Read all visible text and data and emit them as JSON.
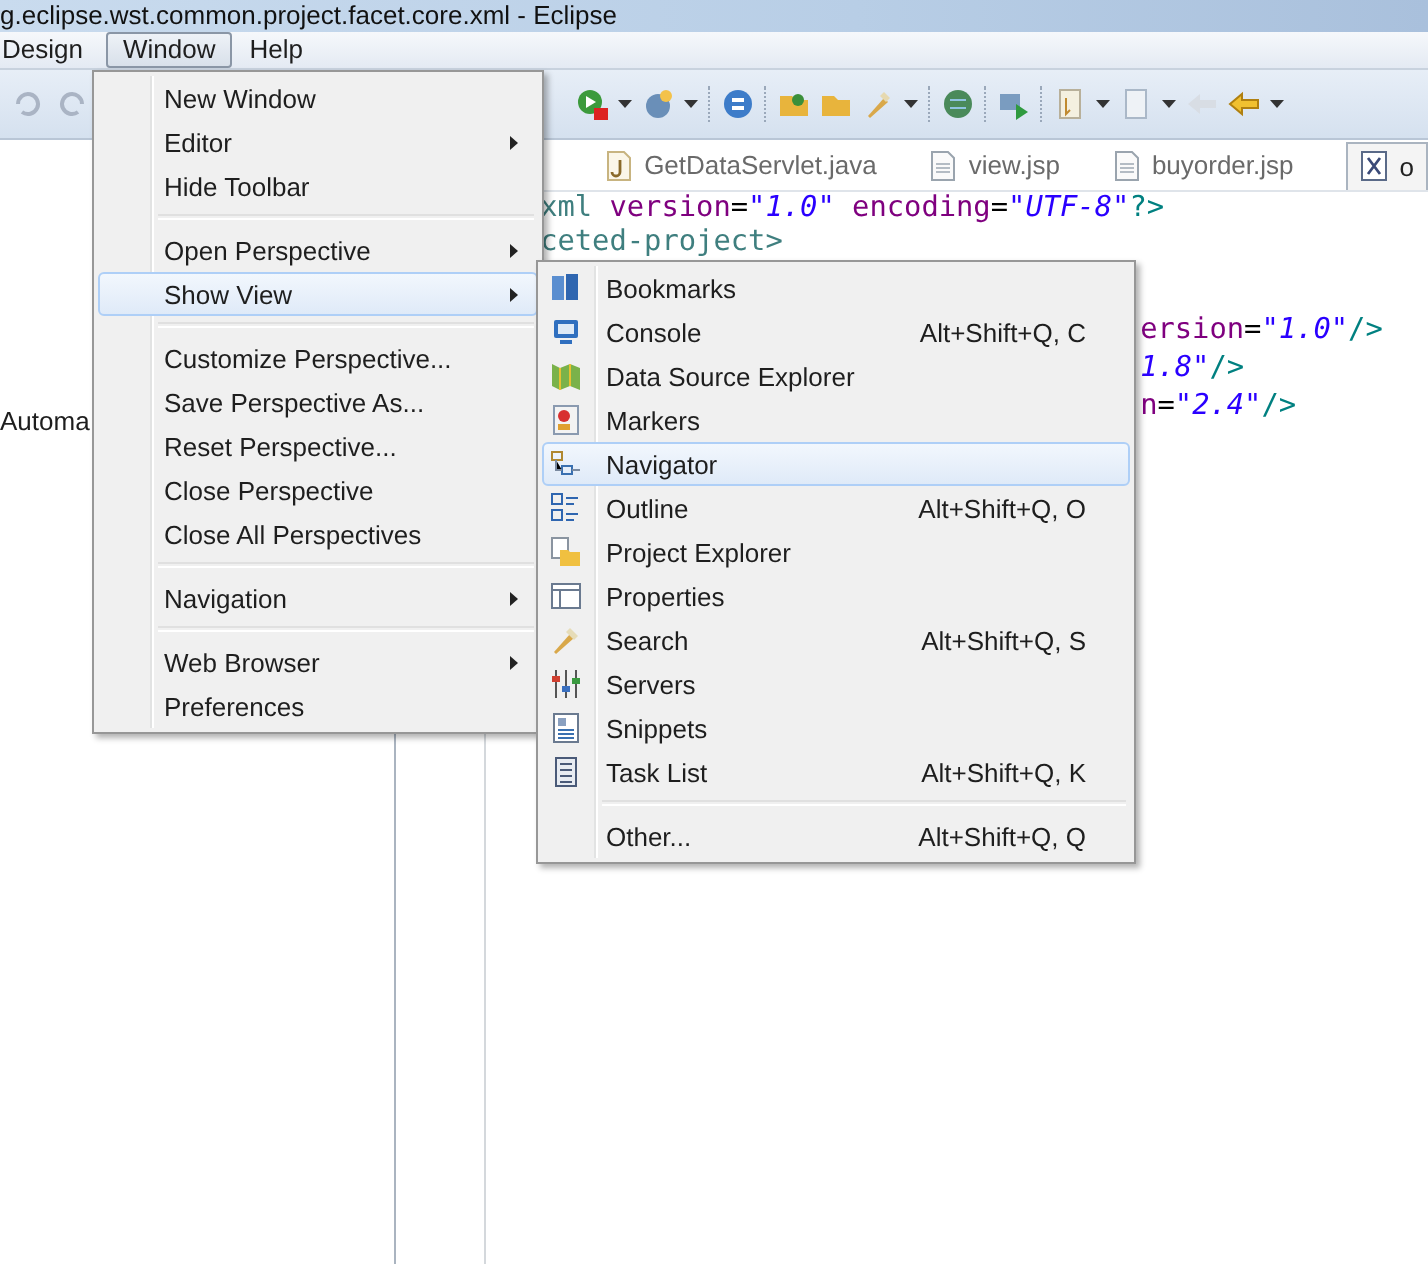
{
  "window": {
    "title": "g.eclipse.wst.common.project.facet.core.xml - Eclipse"
  },
  "menu_bar": [
    {
      "label": "Design",
      "selected": false
    },
    {
      "label": "Window",
      "selected": true
    },
    {
      "label": "Help",
      "selected": false
    }
  ],
  "left_panel": {
    "text": "Automa"
  },
  "editor_tabs": [
    {
      "label": "GetDataServlet.java",
      "kind": "java",
      "selected": false
    },
    {
      "label": "view.jsp",
      "kind": "page",
      "selected": false
    },
    {
      "label": "buyorder.jsp",
      "kind": "page",
      "selected": false
    },
    {
      "label": "o",
      "kind": "xml",
      "selected": true
    }
  ],
  "code_lines": [
    {
      "kind": "left",
      "segments": [
        {
          "text": "xml",
          "kind": "tag"
        },
        {
          "text": " version",
          "kind": "attr"
        },
        {
          "text": "=",
          "kind": "plain"
        },
        {
          "text": "\"1.0\"",
          "kind": "value"
        },
        {
          "text": " encoding",
          "kind": "attr"
        },
        {
          "text": "=",
          "kind": "plain"
        },
        {
          "text": "\"UTF-8\"",
          "kind": "value"
        },
        {
          "text": "?>",
          "kind": "bracket"
        }
      ]
    },
    {
      "kind": "left",
      "segments": [
        {
          "text": "ceted-project>",
          "kind": "tag"
        }
      ]
    },
    {
      "kind": "right",
      "segments": [
        {
          "text": "ersion",
          "kind": "attr"
        },
        {
          "text": "=",
          "kind": "plain"
        },
        {
          "text": "\"1.0\"",
          "kind": "value"
        },
        {
          "text": "/>",
          "kind": "bracket"
        }
      ]
    },
    {
      "kind": "right",
      "segments": [
        {
          "text": "1.8\"",
          "kind": "value"
        },
        {
          "text": "/>",
          "kind": "bracket"
        }
      ]
    },
    {
      "kind": "right",
      "segments": [
        {
          "text": "n",
          "kind": "attr"
        },
        {
          "text": "=",
          "kind": "plain"
        },
        {
          "text": "\"2.4\"",
          "kind": "value"
        },
        {
          "text": "/>",
          "kind": "bracket"
        }
      ]
    }
  ],
  "window_menu": [
    {
      "kind": "item",
      "label": "New Window",
      "submenu": false,
      "selected": false
    },
    {
      "kind": "item",
      "label": "Editor",
      "submenu": true,
      "selected": false
    },
    {
      "kind": "item",
      "label": "Hide Toolbar",
      "submenu": false,
      "selected": false
    },
    {
      "kind": "separator"
    },
    {
      "kind": "item",
      "label": "Open Perspective",
      "submenu": true,
      "selected": false
    },
    {
      "kind": "item",
      "label": "Show View",
      "submenu": true,
      "selected": true
    },
    {
      "kind": "separator"
    },
    {
      "kind": "item",
      "label": "Customize Perspective...",
      "submenu": false,
      "selected": false
    },
    {
      "kind": "item",
      "label": "Save Perspective As...",
      "submenu": false,
      "selected": false
    },
    {
      "kind": "item",
      "label": "Reset Perspective...",
      "submenu": false,
      "selected": false
    },
    {
      "kind": "item",
      "label": "Close Perspective",
      "submenu": false,
      "selected": false
    },
    {
      "kind": "item",
      "label": "Close All Perspectives",
      "submenu": false,
      "selected": false
    },
    {
      "kind": "separator"
    },
    {
      "kind": "item",
      "label": "Navigation",
      "submenu": true,
      "selected": false
    },
    {
      "kind": "separator"
    },
    {
      "kind": "item",
      "label": "Web Browser",
      "submenu": true,
      "selected": false
    },
    {
      "kind": "item",
      "label": "Preferences",
      "submenu": false,
      "selected": false
    }
  ],
  "show_view_menu": [
    {
      "kind": "item",
      "label": "Bookmarks",
      "selected": false
    },
    {
      "kind": "item",
      "label": "Console",
      "shortcut": "Alt+Shift+Q, C",
      "selected": false
    },
    {
      "kind": "item",
      "label": "Data Source Explorer",
      "selected": false
    },
    {
      "kind": "item",
      "label": "Markers",
      "selected": false
    },
    {
      "kind": "item",
      "label": "Navigator",
      "selected": true
    },
    {
      "kind": "item",
      "label": "Outline",
      "shortcut": "Alt+Shift+Q, O",
      "selected": false
    },
    {
      "kind": "item",
      "label": "Project Explorer",
      "selected": false
    },
    {
      "kind": "item",
      "label": "Properties",
      "selected": false
    },
    {
      "kind": "item",
      "label": "Search",
      "shortcut": "Alt+Shift+Q, S",
      "selected": false
    },
    {
      "kind": "item",
      "label": "Servers",
      "selected": false
    },
    {
      "kind": "item",
      "label": "Snippets",
      "selected": false
    },
    {
      "kind": "item",
      "label": "Task List",
      "shortcut": "Alt+Shift+Q, K",
      "selected": false
    },
    {
      "kind": "separator"
    },
    {
      "kind": "item",
      "label": "Other...",
      "shortcut": "Alt+Shift+Q, Q",
      "selected": false
    }
  ]
}
